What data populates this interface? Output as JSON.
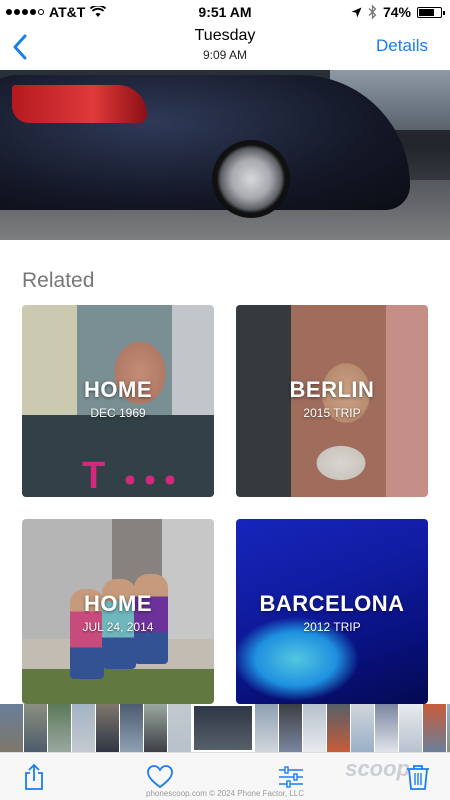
{
  "status_bar": {
    "carrier": "AT&T",
    "time": "9:51 AM",
    "battery": "74%",
    "battery_level": 0.74,
    "signal_bars": 4
  },
  "nav": {
    "back_icon": "chevron-left-icon",
    "title": "Tuesday",
    "subtitle": "9:09 AM",
    "details_label": "Details",
    "accent_color": "#1a7df2"
  },
  "related": {
    "heading": "Related",
    "albums": [
      {
        "title": "HOME",
        "subtitle": "DEC 1969"
      },
      {
        "title": "BERLIN",
        "subtitle": "2015 TRIP"
      },
      {
        "title": "HOME",
        "subtitle": "JUL 24, 2014"
      },
      {
        "title": "BARCELONA",
        "subtitle": "2012 TRIP"
      }
    ]
  },
  "filmstrip": {
    "thumbnail_count": 20,
    "selected_index": 8
  },
  "toolbar": {
    "items": [
      "share-icon",
      "heart-icon",
      "adjust-icon",
      "trash-icon"
    ]
  },
  "watermark": {
    "logo": "scoop",
    "text": "phonescoop.com © 2024 Phone Factor, LLC"
  }
}
